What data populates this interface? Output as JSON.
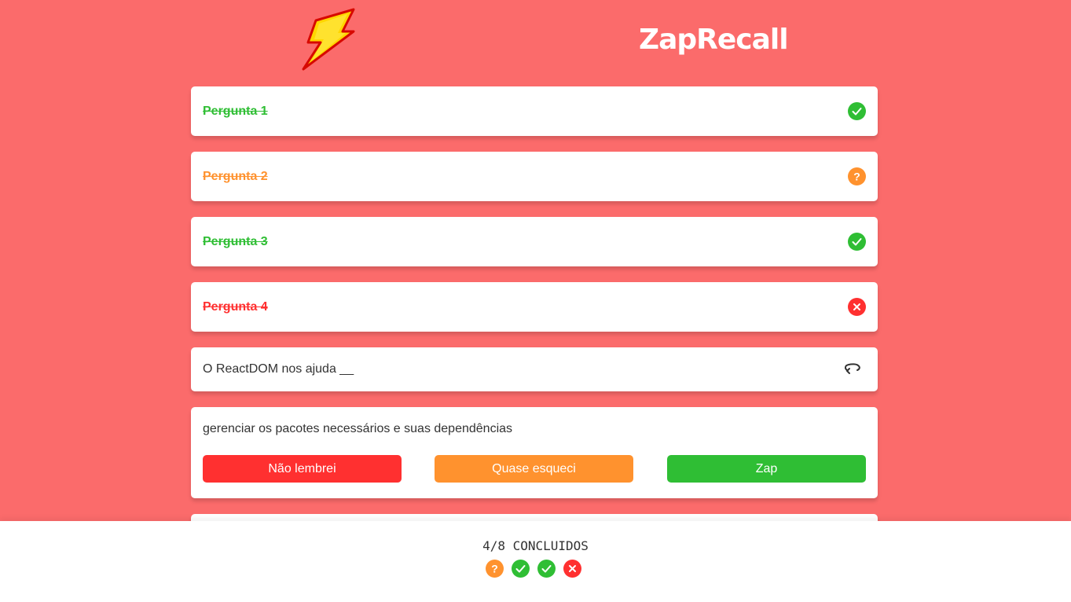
{
  "app": {
    "title": "ZapRecall",
    "logo_icon": "lightning-bolt-icon"
  },
  "colors": {
    "background": "#FB6B6B",
    "green": "#2FBE34",
    "orange": "#FF922E",
    "red": "#FF3030"
  },
  "cards": [
    {
      "label": "Pergunta 1",
      "status": "correct",
      "icon": "check-circle-icon"
    },
    {
      "label": "Pergunta 2",
      "status": "almost",
      "icon": "question-circle-icon"
    },
    {
      "label": "Pergunta 3",
      "status": "correct",
      "icon": "check-circle-icon"
    },
    {
      "label": "Pergunta 4",
      "status": "wrong",
      "icon": "x-circle-icon"
    }
  ],
  "question": {
    "text": "O ReactDOM nos ajuda __",
    "icon": "flip-arrow-icon"
  },
  "answer": {
    "text": "gerenciar os pacotes necessários e suas dependências",
    "buttons": {
      "not_remembered": "Não lembrei",
      "almost_forgot": "Quase esqueci",
      "zap": "Zap"
    }
  },
  "footer": {
    "progress": "4/8 CONCLUIDOS",
    "results": [
      "almost",
      "correct",
      "correct",
      "wrong"
    ]
  }
}
